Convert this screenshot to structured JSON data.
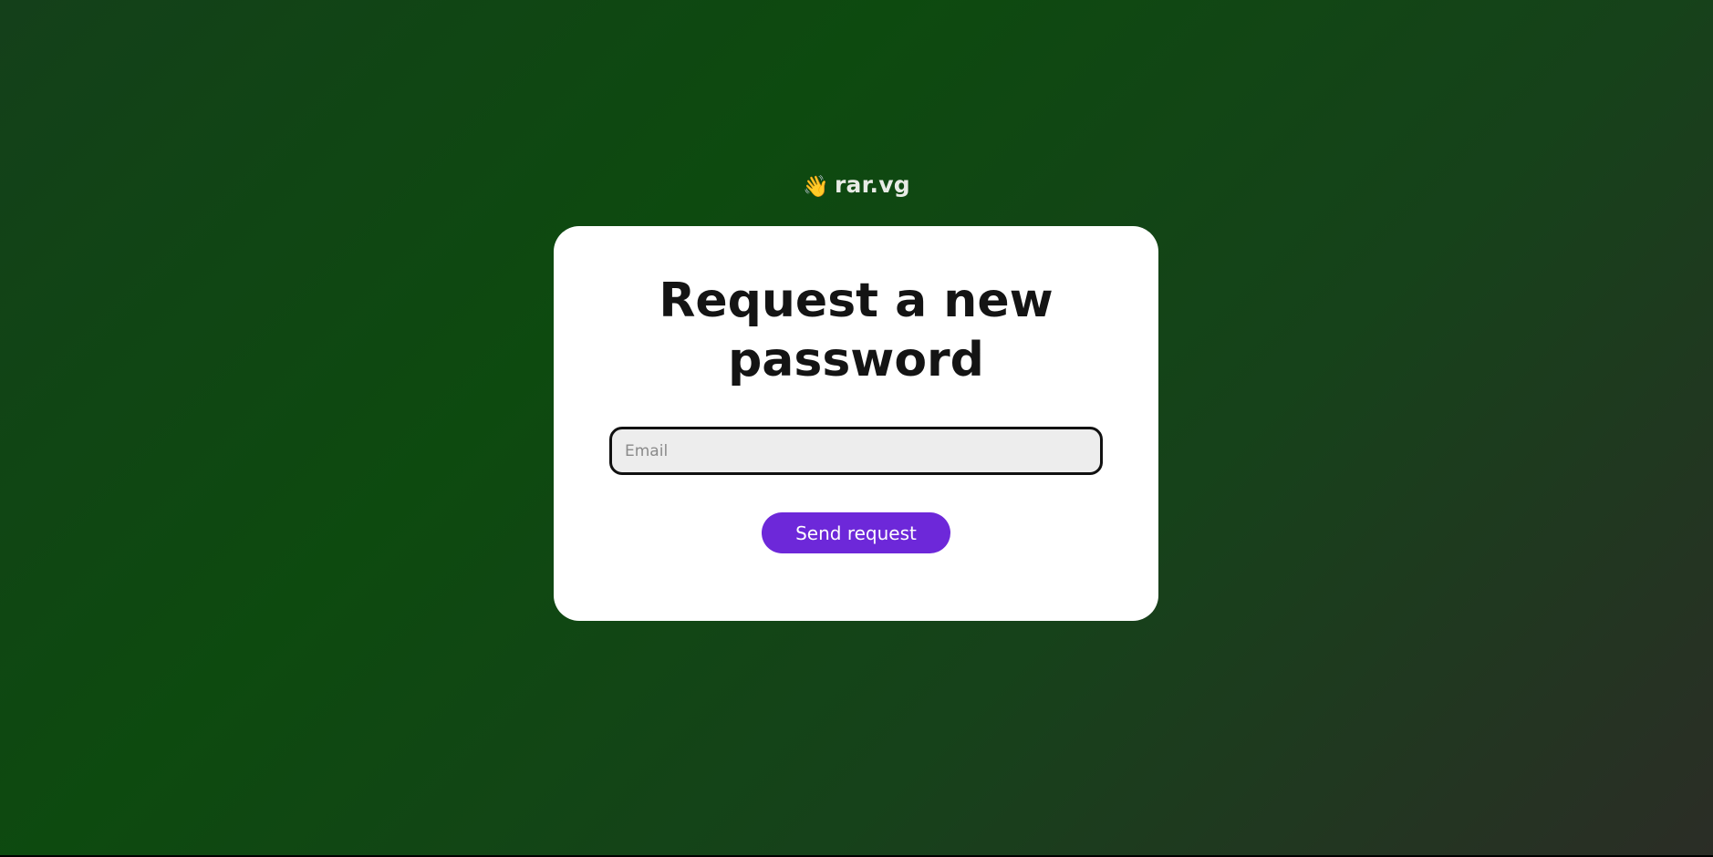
{
  "brand": {
    "icon": "waving-hand-icon",
    "name": "rar.vg"
  },
  "form": {
    "title": "Request a new password",
    "email_placeholder": "Email",
    "email_value": "",
    "submit_label": "Send request"
  },
  "colors": {
    "accent": "#6d28d9",
    "background_start": "#14401a",
    "background_end": "#2b2d26",
    "card": "#ffffff"
  }
}
